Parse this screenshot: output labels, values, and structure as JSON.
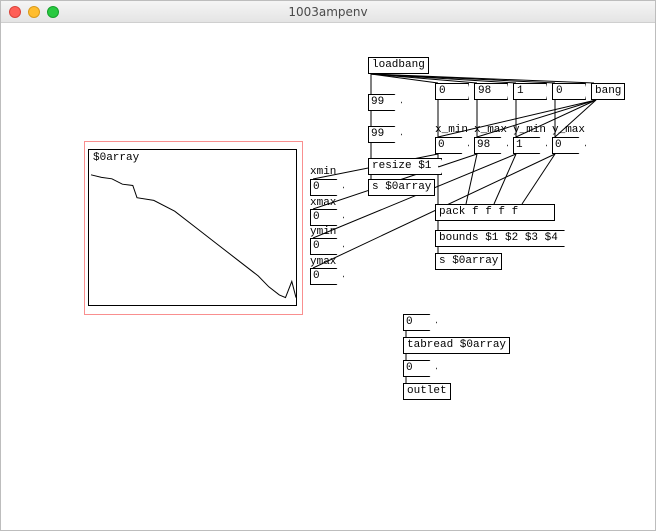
{
  "window": {
    "title": "1003ampenv"
  },
  "objects": {
    "loadbang": "loadbang",
    "resize": "resize $1",
    "s_array": "s $0array",
    "pack": "pack f f f f",
    "bounds": "bounds $1 $2 $3 $4",
    "s_array2": "s $0array",
    "tabread": "tabread $0array",
    "outlet": "outlet",
    "bang": "bang"
  },
  "numbers": {
    "n99a": "99",
    "n99b": "99",
    "xmin_top": "0",
    "xmax_top": "98",
    "ymin_top": "1",
    "ymax_top": "0",
    "xmin_row": "0",
    "xmax_row": "98",
    "ymin_row": "1",
    "ymax_row": "0",
    "xmin_box": "0",
    "xmax_box": "0",
    "ymin_box": "0",
    "ymax_box": "0",
    "tabread_in": "0",
    "tabread_out": "0"
  },
  "labels": {
    "xmin": "xmin",
    "xmax": "xmax",
    "ymin": "ymin",
    "ymax": "ymax",
    "x_min": "x_min",
    "x_max": "x_max",
    "y_min": "y_min",
    "y_max": "y_max",
    "array": "$0array"
  },
  "chart_data": {
    "type": "line",
    "title": "$0array",
    "xlabel": "",
    "ylabel": "",
    "xlim": [
      0,
      98
    ],
    "ylim": [
      0,
      1
    ],
    "x": [
      0,
      5,
      10,
      15,
      20,
      22,
      30,
      40,
      50,
      60,
      70,
      80,
      85,
      90,
      93,
      96,
      98
    ],
    "values": [
      0.95,
      0.93,
      0.92,
      0.88,
      0.87,
      0.78,
      0.76,
      0.68,
      0.56,
      0.44,
      0.32,
      0.2,
      0.12,
      0.06,
      0.04,
      0.16,
      0.04
    ]
  }
}
